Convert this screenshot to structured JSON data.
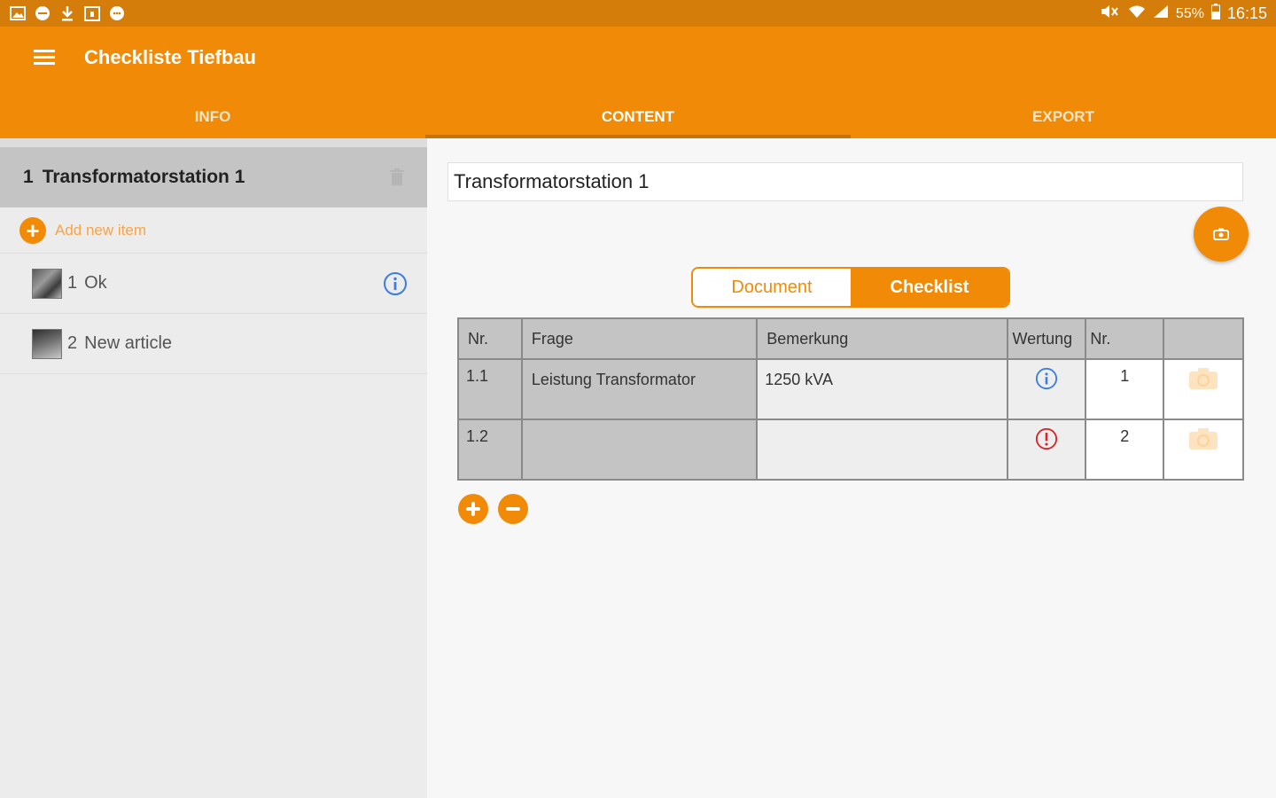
{
  "status_bar": {
    "battery": "55%",
    "time": "16:15",
    "left_icons": [
      "gallery-icon",
      "message-icon",
      "download-icon",
      "calendar-icon",
      "chat-icon"
    ],
    "right_icons": [
      "mute-icon",
      "wifi-icon",
      "signal-icon",
      "battery-icon"
    ]
  },
  "app": {
    "title": "Checkliste Tiefbau",
    "accent": "#f18a07",
    "status_color": "#d47d0a"
  },
  "tabs": [
    {
      "label": "INFO",
      "active": false
    },
    {
      "label": "CONTENT",
      "active": true
    },
    {
      "label": "EXPORT",
      "active": false
    }
  ],
  "sidebar": {
    "group": {
      "number": "1",
      "title": "Transformatorstation 1"
    },
    "add_label": "Add new item",
    "items": [
      {
        "number": "1",
        "label": "Ok",
        "icon": "info-icon"
      },
      {
        "number": "2",
        "label": "New article"
      }
    ]
  },
  "editor": {
    "title_value": "Transformatorstation 1",
    "segment": {
      "document": "Document",
      "checklist": "Checklist",
      "selected": "Checklist"
    },
    "table": {
      "headers": [
        "Nr.",
        "Frage",
        "Bemerkung",
        "Wertung",
        "Nr.",
        ""
      ],
      "rows": [
        {
          "nr": "1.1",
          "frage": "Leistung Transformator",
          "bemerkung": "1250 kVA",
          "wertung": "info",
          "nr2": "1"
        },
        {
          "nr": "1.2",
          "frage": "",
          "bemerkung": "",
          "wertung": "warning",
          "nr2": "2"
        }
      ]
    }
  }
}
